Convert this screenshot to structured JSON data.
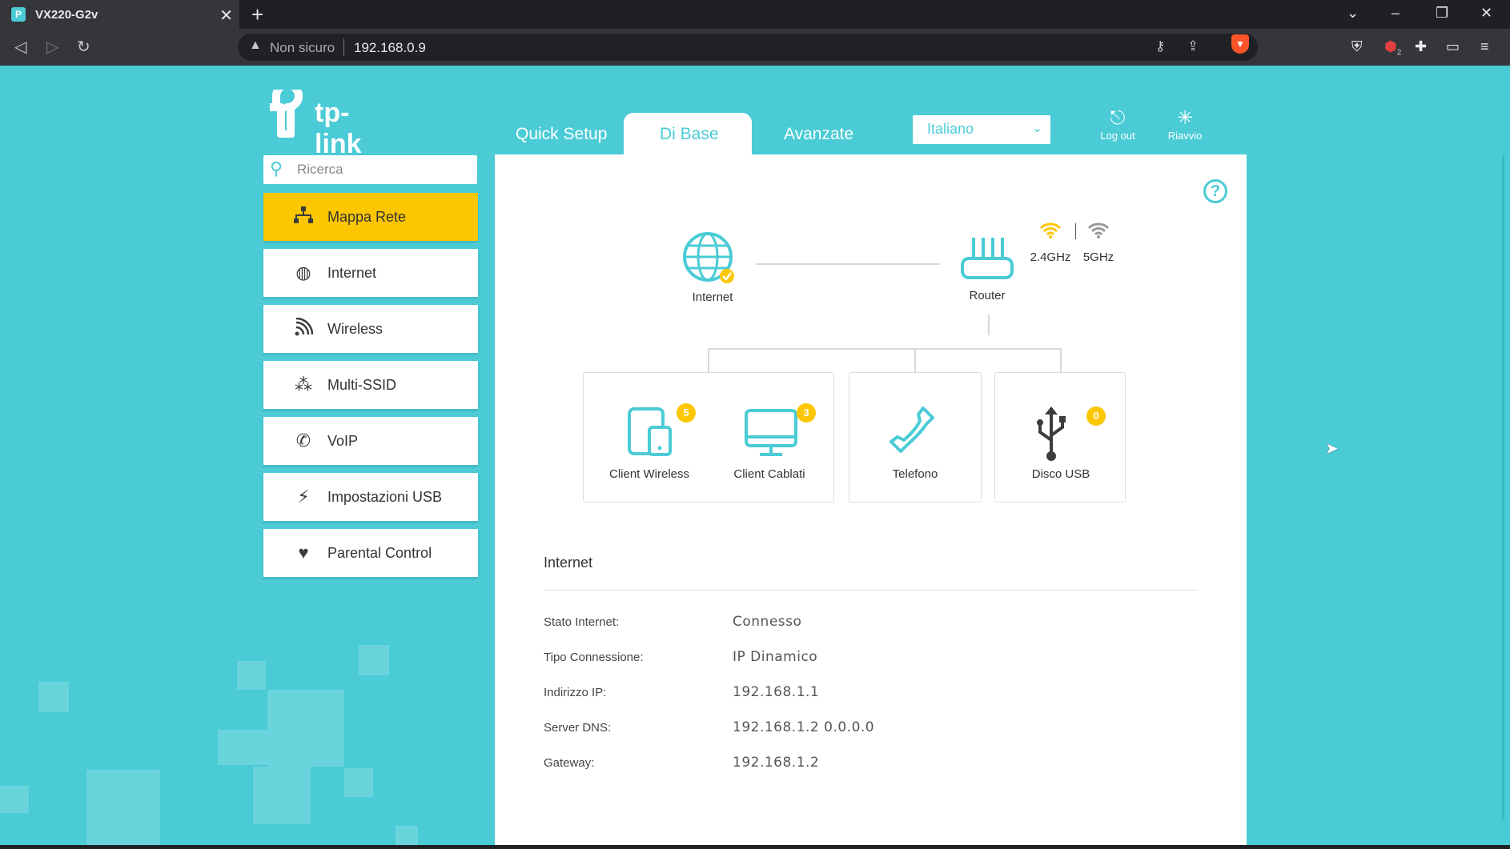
{
  "browser": {
    "tab_title": "VX220-G2v",
    "security_label": "Non sicuro",
    "url": "192.168.0.9",
    "ext_badge": "2"
  },
  "header": {
    "logo_text": "tp-link",
    "tabs": [
      {
        "label": "Quick Setup"
      },
      {
        "label": "Di Base"
      },
      {
        "label": "Avanzate"
      }
    ],
    "language": "Italiano",
    "logout_label": "Log out",
    "reboot_label": "Riavvio"
  },
  "sidebar": {
    "search_placeholder": "Ricerca",
    "items": [
      {
        "label": "Mappa Rete",
        "icon": "network-map-icon"
      },
      {
        "label": "Internet",
        "icon": "globe-icon"
      },
      {
        "label": "Wireless",
        "icon": "wifi-icon"
      },
      {
        "label": "Multi-SSID",
        "icon": "multi-ssid-icon"
      },
      {
        "label": "VoIP",
        "icon": "phone-icon"
      },
      {
        "label": "Impostazioni USB",
        "icon": "usb-icon"
      },
      {
        "label": "Parental Control",
        "icon": "heart-icon"
      }
    ]
  },
  "map": {
    "internet_label": "Internet",
    "router_label": "Router",
    "band_24": "2.4GHz",
    "band_5": "5GHz",
    "devices": [
      {
        "label": "Client Wireless",
        "count": "5"
      },
      {
        "label": "Client Cablati",
        "count": "3"
      },
      {
        "label": "Telefono"
      },
      {
        "label": "Disco USB",
        "count": "0"
      }
    ]
  },
  "internet_info": {
    "title": "Internet",
    "rows": [
      {
        "key": "Stato Internet:",
        "value": "Connesso"
      },
      {
        "key": "Tipo Connessione:",
        "value": "IP Dinamico"
      },
      {
        "key": "Indirizzo IP:",
        "value": "192.168.1.1"
      },
      {
        "key": "Server DNS:",
        "value": "192.168.1.2 0.0.0.0"
      },
      {
        "key": "Gateway:",
        "value": "192.168.1.2"
      }
    ]
  },
  "colors": {
    "brand": "#4acbd6",
    "accent": "#fcc600"
  }
}
